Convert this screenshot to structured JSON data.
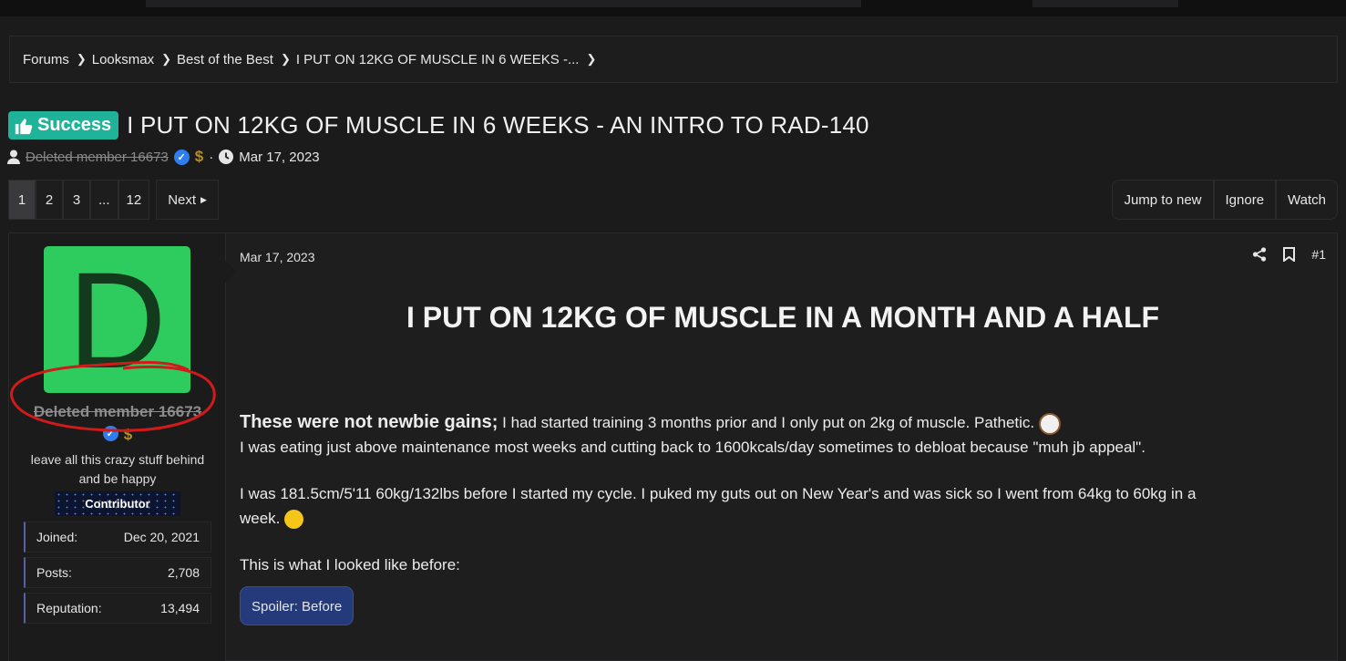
{
  "breadcrumb": [
    "Forums",
    "Looksmax",
    "Best of the Best",
    "I PUT ON 12KG OF MUSCLE IN 6 WEEKS -..."
  ],
  "thread": {
    "prefix": "Success",
    "title": "I PUT ON 12KG OF MUSCLE IN 6 WEEKS - AN INTRO TO RAD-140",
    "author": "Deleted member 16673",
    "date": "Mar 17, 2023",
    "separator": "·"
  },
  "pagination": {
    "pages": [
      "1",
      "2",
      "3",
      "...",
      "12"
    ],
    "next": "Next"
  },
  "thread_actions": [
    "Jump to new",
    "Ignore",
    "Watch"
  ],
  "user": {
    "avatar_letter": "D",
    "name": "Deleted member 16673",
    "title_line1": "leave all this crazy stuff behind",
    "title_line2": "and be happy",
    "banner": "Contributor",
    "stats": [
      {
        "label": "Joined:",
        "value": "Dec 20, 2021"
      },
      {
        "label": "Posts:",
        "value": "2,708"
      },
      {
        "label": "Reputation:",
        "value": "13,494"
      }
    ]
  },
  "post": {
    "date": "Mar 17, 2023",
    "number": "#1",
    "heading": "I PUT ON 12KG OF MUSCLE IN A MONTH AND A HALF",
    "lead": "These were not newbie gains;",
    "line1_rest": " I had started training 3 months prior and I only put on 2kg of muscle. Pathetic.",
    "line2": "I was eating just above maintenance most weeks and cutting back to 1600kcals/day sometimes to debloat because \"muh jb appeal\".",
    "line3a": "I was 181.5cm/5'11 60kg/132lbs before I started my cycle. I puked my guts out on New Year's and was sick so I went from 64kg to 60kg in a",
    "line3b": "week.",
    "line4": "This is what I looked like before:",
    "spoiler": "Spoiler: Before"
  },
  "colors": {
    "success_prefix": "#1fb39a",
    "avatar_bg": "#2ecc5e",
    "annotation_circle": "#d11a1a",
    "spoiler_bg": "#243a7a"
  }
}
